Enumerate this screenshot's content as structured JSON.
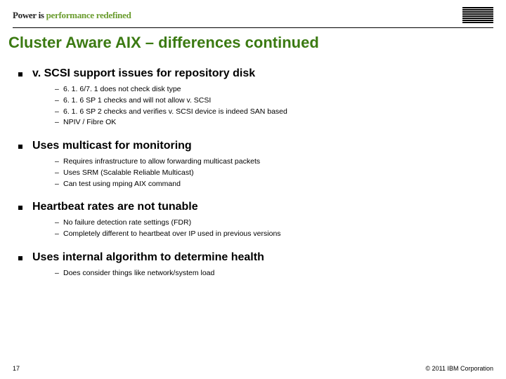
{
  "header": {
    "tagline_pre": "Power is ",
    "tagline_hl": "performance redefined",
    "logo_name": "ibm-logo"
  },
  "title": "Cluster Aware AIX – differences continued",
  "sections": [
    {
      "heading": "v. SCSI support issues for repository disk",
      "items": [
        "6. 1. 6/7. 1 does not check disk type",
        "6. 1. 6 SP 1 checks and will not allow v. SCSI",
        "6. 1. 6 SP 2 checks and verifies v. SCSI device is indeed SAN based",
        "NPIV / Fibre OK"
      ]
    },
    {
      "heading": "Uses multicast for monitoring",
      "items": [
        "Requires infrastructure to allow forwarding multicast packets",
        "Uses SRM (Scalable Reliable Multicast)",
        "Can test using mping AIX command"
      ]
    },
    {
      "heading": "Heartbeat rates are not tunable",
      "items": [
        "No failure detection rate settings (FDR)",
        "Completely different to heartbeat over IP used in previous versions"
      ]
    },
    {
      "heading": "Uses internal algorithm to determine health",
      "items": [
        "Does consider things like network/system load"
      ]
    }
  ],
  "footer": {
    "page": "17",
    "copyright": "© 2011 IBM Corporation"
  }
}
